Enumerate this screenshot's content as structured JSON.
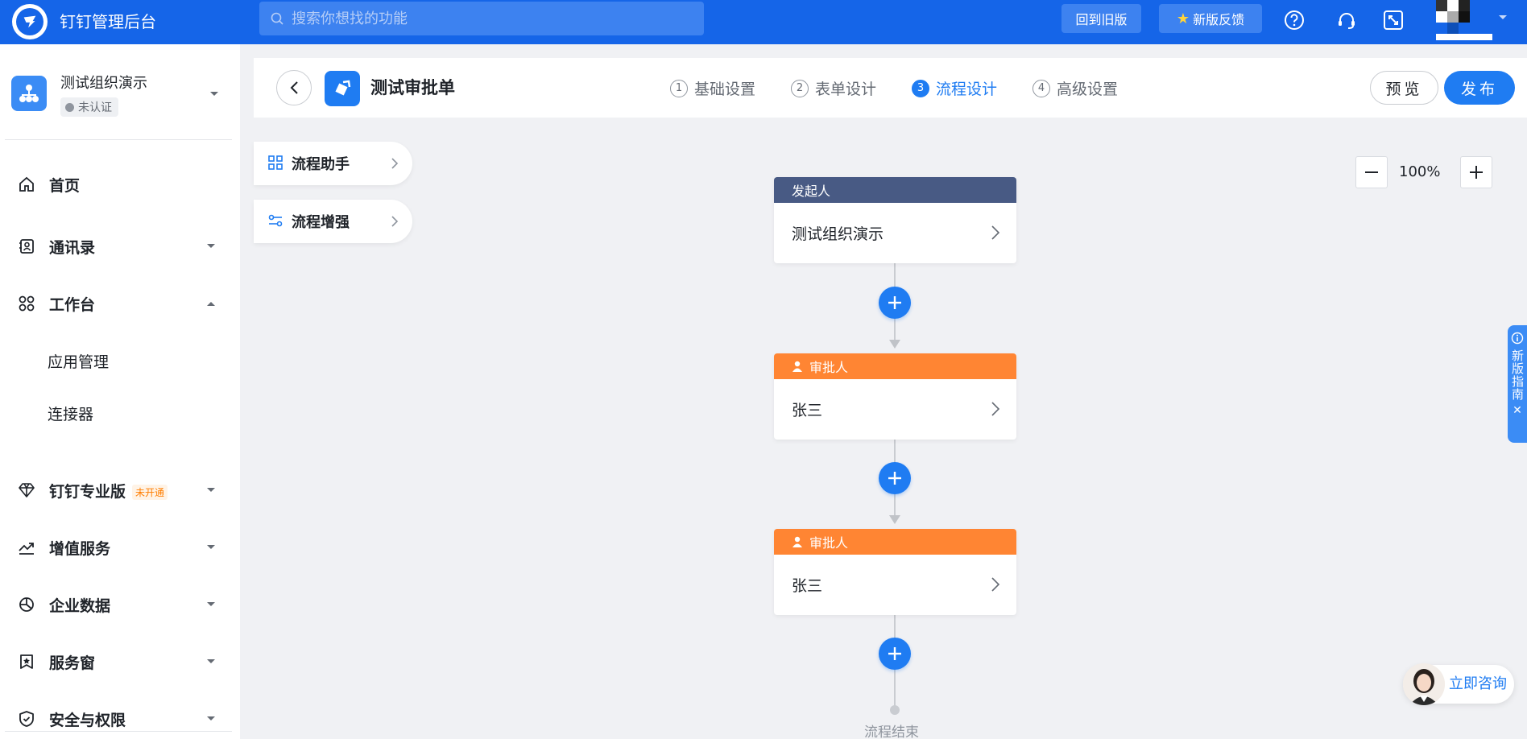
{
  "topbar": {
    "app_title": "钉钉管理后台",
    "search_placeholder": "搜索你想找的功能",
    "old_version_label": "回到旧版",
    "feedback_label": "新版反馈"
  },
  "sidebar": {
    "org_name": "测试组织演示",
    "org_status": "未认证",
    "items": [
      {
        "label": "首页",
        "icon": "home-icon"
      },
      {
        "label": "通讯录",
        "icon": "contacts-icon"
      },
      {
        "label": "工作台",
        "icon": "grid-icon"
      },
      {
        "label": "钉钉专业版",
        "icon": "diamond-icon",
        "tag": "未开通"
      },
      {
        "label": "增值服务",
        "icon": "trend-icon"
      },
      {
        "label": "企业数据",
        "icon": "pie-icon"
      },
      {
        "label": "服务窗",
        "icon": "bookmark-icon"
      },
      {
        "label": "安全与权限",
        "icon": "shield-icon"
      }
    ],
    "sub_items": [
      "应用管理",
      "连接器"
    ]
  },
  "header": {
    "form_title": "测试审批单",
    "steps": [
      {
        "num": "1",
        "label": "基础设置"
      },
      {
        "num": "2",
        "label": "表单设计"
      },
      {
        "num": "3",
        "label": "流程设计"
      },
      {
        "num": "4",
        "label": "高级设置"
      }
    ],
    "active_step": 3,
    "preview_label": "预览",
    "publish_label": "发布"
  },
  "assistants": [
    "流程助手",
    "流程增强"
  ],
  "zoom": {
    "value": "100%"
  },
  "flow": {
    "nodes": [
      {
        "type": "start",
        "head": "发起人",
        "body": "测试组织演示"
      },
      {
        "type": "approve",
        "head": "审批人",
        "body": "张三"
      },
      {
        "type": "approve",
        "head": "审批人",
        "body": "张三"
      }
    ],
    "end_label": "流程结束"
  },
  "guide": {
    "label": "新版指南"
  },
  "consult": {
    "label": "立即咨询"
  },
  "colors": {
    "brand": "#1565e8",
    "primary": "#1f7cf2",
    "start_node": "#485a84",
    "approve_node": "#ff8533"
  }
}
